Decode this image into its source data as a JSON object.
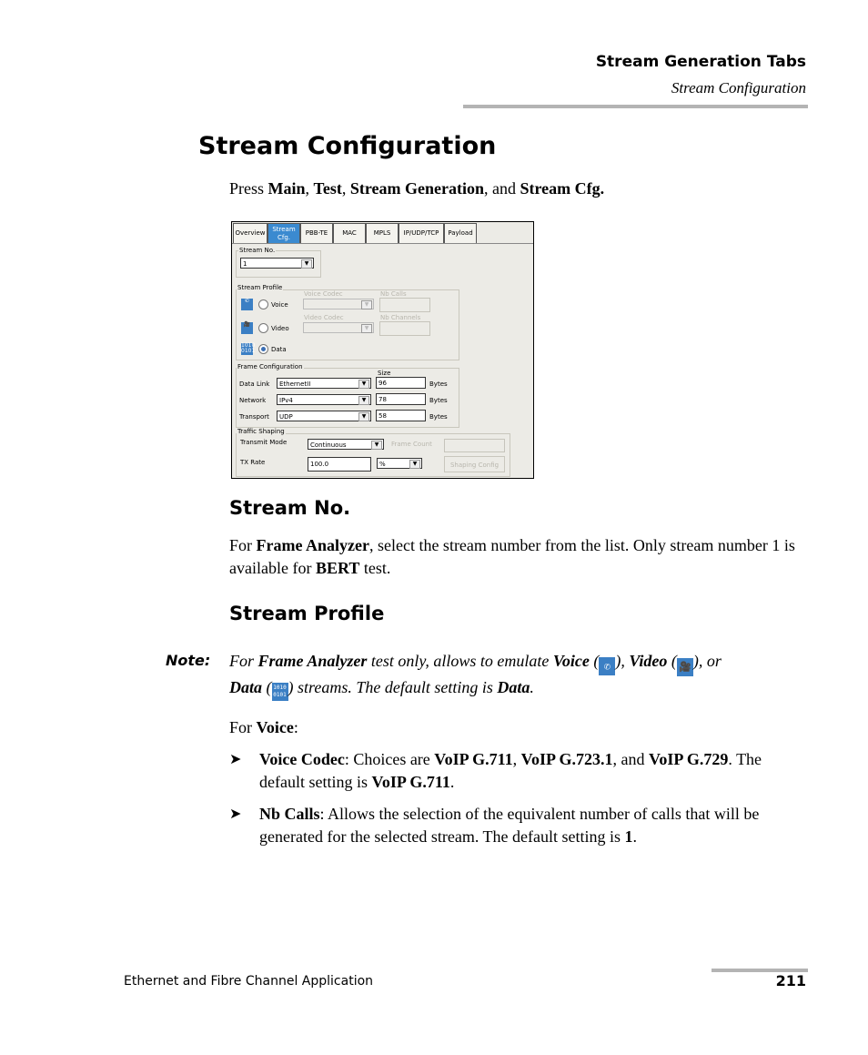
{
  "header": {
    "chapter": "Stream Generation Tabs",
    "section": "Stream Configuration"
  },
  "page_title": "Stream Configuration",
  "press_instruction": {
    "prefix": "Press ",
    "items": [
      "Main",
      "Test",
      "Stream Generation",
      "Stream Cfg."
    ],
    "sep1": ", ",
    "sep2": ", ",
    "sep3": ", and "
  },
  "screenshot": {
    "tabs": [
      {
        "label": "Overview",
        "active": false
      },
      {
        "label_line1": "Stream",
        "label_line2": "Cfg.",
        "active": true
      },
      {
        "label": "PBB-TE",
        "active": false
      },
      {
        "label": "MAC",
        "active": false
      },
      {
        "label": "MPLS",
        "active": false
      },
      {
        "label": "IP/UDP/TCP",
        "active": false
      },
      {
        "label": "Payload",
        "active": false
      }
    ],
    "stream_no": {
      "label": "Stream No.",
      "value": "1"
    },
    "stream_profile": {
      "label": "Stream Profile",
      "voice": {
        "label": "Voice",
        "icon": "phone-icon",
        "selected": false,
        "codec_label": "Voice Codec",
        "count_label": "Nb Calls"
      },
      "video": {
        "label": "Video",
        "icon": "video-camera-icon",
        "selected": false,
        "codec_label": "Video Codec",
        "count_label": "Nb Channels"
      },
      "data": {
        "label": "Data",
        "icon": "binary-data-icon",
        "selected": true,
        "icon_text1": "1010",
        "icon_text2": "0101"
      }
    },
    "frame_config": {
      "label": "Frame Configuration",
      "size_header": "Size",
      "rows": [
        {
          "label": "Data Link",
          "value": "EthernetII",
          "size": "96",
          "unit": "Bytes"
        },
        {
          "label": "Network",
          "value": "IPv4",
          "size": "78",
          "unit": "Bytes"
        },
        {
          "label": "Transport",
          "value": "UDP",
          "size": "58",
          "unit": "Bytes"
        }
      ]
    },
    "traffic_shaping": {
      "label": "Traffic Shaping",
      "transmit_mode_label": "Transmit Mode",
      "transmit_mode_value": "Continuous",
      "frame_count_label": "Frame Count",
      "tx_rate_label": "TX Rate",
      "tx_rate_value": "100.0",
      "tx_rate_unit": "%",
      "shaping_config_label": "Shaping Config"
    }
  },
  "stream_no_section": {
    "heading": "Stream No.",
    "t1": "For ",
    "b1": "Frame Analyzer",
    "t2": ", select the stream number from the list. Only stream number 1 is available for ",
    "b2": "BERT",
    "t3": " test."
  },
  "stream_profile_section": {
    "heading": "Stream Profile",
    "note_label": "Note:",
    "note": {
      "t1": "For ",
      "b1": "Frame Analyzer",
      "t2": " test only, allows to emulate ",
      "b2": "Voice",
      "t3": " (",
      "t4": "), ",
      "b3": "Video",
      "t5": " (",
      "t6": "), or ",
      "b4": "Data",
      "t7": " (",
      "t8": ") streams. The default setting is ",
      "b5": "Data",
      "t9": "."
    },
    "for_voice": {
      "t1": "For ",
      "b1": "Voice",
      "t2": ":"
    },
    "bullets": [
      {
        "b1": "Voice Codec",
        "t1": ": Choices are ",
        "b2": "VoIP G.711",
        "t2": ", ",
        "b3": "VoIP G.723.1",
        "t3": ", and ",
        "b4": "VoIP G.729",
        "t4": ". The default setting is ",
        "b5": "VoIP G.711",
        "t5": "."
      },
      {
        "b1": "Nb Calls",
        "t1": ": Allows the selection of the equivalent number of calls that will be generated for the selected stream. The default setting is ",
        "b2": "1",
        "t2": "."
      }
    ],
    "bullet_glyph": "➤"
  },
  "footer": {
    "title": "Ethernet and Fibre Channel Application",
    "page_number": "211"
  }
}
